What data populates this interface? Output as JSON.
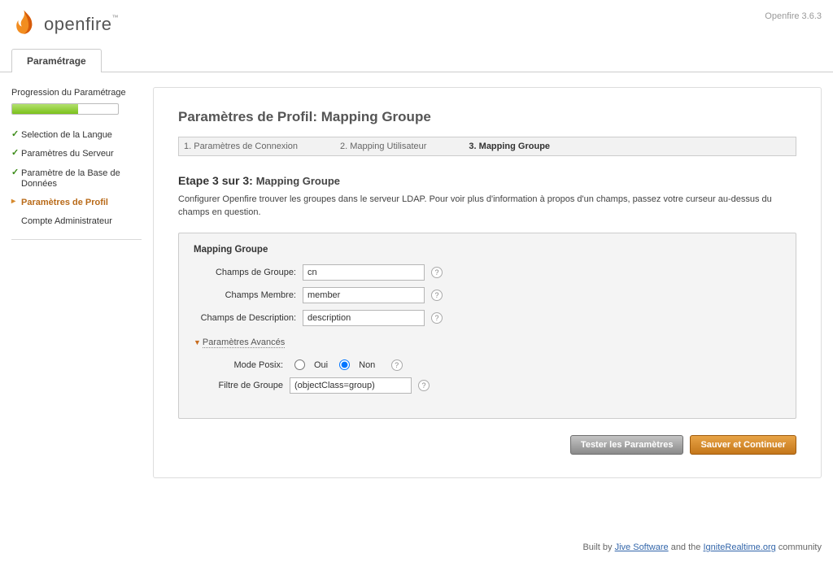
{
  "header": {
    "product": "openfire",
    "version": "Openfire 3.6.3"
  },
  "tab": {
    "label": "Paramétrage"
  },
  "sidebar": {
    "progress_title": "Progression du Paramétrage",
    "items": [
      {
        "label": "Selection de la Langue"
      },
      {
        "label": "Paramètres du Serveur"
      },
      {
        "label": "Paramètre de la Base de Données"
      },
      {
        "label": "Paramètres de Profil"
      },
      {
        "label": "Compte Administrateur"
      }
    ]
  },
  "main": {
    "title": "Paramètres de Profil: Mapping Groupe",
    "steps": [
      "1. Paramètres de Connexion",
      "2. Mapping Utilisateur",
      "3. Mapping Groupe"
    ],
    "heading_main": "Etape 3 sur 3:",
    "heading_sub": "Mapping Groupe",
    "description": "Configurer Openfire trouver les groupes dans le serveur LDAP. Pour voir plus d'information à propos d'un champs, passez votre curseur au-dessus du champs en question.",
    "form": {
      "box_title": "Mapping Groupe",
      "group_label": "Champs de Groupe:",
      "group_value": "cn",
      "member_label": "Champs Membre:",
      "member_value": "member",
      "desc_label": "Champs de Description:",
      "desc_value": "description",
      "adv_toggle": "Paramètres Avancés",
      "posix_label": "Mode Posix:",
      "posix_yes": "Oui",
      "posix_no": "Non",
      "filter_label": "Filtre de Groupe",
      "filter_value": "(objectClass=group)"
    },
    "buttons": {
      "test": "Tester les Paramètres",
      "save": "Sauver et Continuer"
    }
  },
  "footer": {
    "prefix": "Built by ",
    "link1": "Jive Software",
    "middle": " and the ",
    "link2": "IgniteRealtime.org",
    "suffix": " community"
  }
}
